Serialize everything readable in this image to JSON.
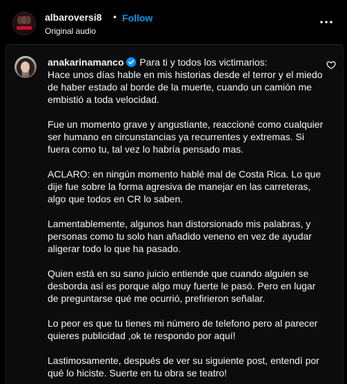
{
  "header": {
    "username": "albaroversi8",
    "separator": "•",
    "follow_label": "Follow",
    "audio_label": "Original audio"
  },
  "comment": {
    "username": "anakarinamanco",
    "intro": "Para ti y todos los victimarios:",
    "paragraphs": [
      "Hace unos días hable en mis historias desde el terror y el miedo de haber estado al borde de la muerte, cuando un camión me embistió a toda velocidad.",
      "Fue un momento grave y angustiante, reaccioné como cualquier ser humano en circunstancias ya recurrentes y extremas. Si fuera como tu, tal vez lo habría pensado mas.",
      "ACLARO: en ningún momento hablé mal de Costa Rica. Lo que dije fue sobre la forma agresiva de manejar en las carreteras, algo que todos en CR lo saben.",
      "Lamentablemente, algunos han distorsionado mis palabras, y personas como tu solo han añadido veneno en vez de ayudar aligerar todo lo que ha pasado.",
      "Quien está en su sano juicio entiende que cuando alguien se desborda así es porque algo muy fuerte le pasó. Pero en lugar de preguntarse qué me ocurrió, prefirieron señalar.",
      "Lo peor es que tu tienes mi número de telefono pero al parecer quieres publicidad ,ok te respondo por aquí!",
      "Lastimosamente, después de ver su siguiente post, entendí por qué lo hiciste. Suerte en tu obra se teatro!"
    ]
  },
  "icons": {
    "verified": "verified-badge-icon",
    "more": "more-options-icon",
    "like": "heart-icon"
  },
  "colors": {
    "background": "#000000",
    "panel": "#0c0c0c",
    "accent": "#0095f6",
    "text": "#f5f5f5"
  }
}
